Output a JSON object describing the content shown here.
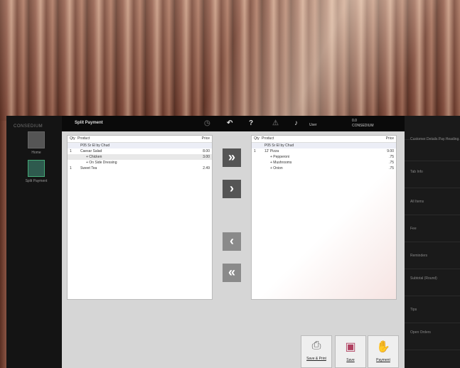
{
  "app": {
    "brand": "CONSEDIUM",
    "title": "Split Payment"
  },
  "left_nav": [
    {
      "label": "Home",
      "icon": "home-icon"
    },
    {
      "label": "Split Payment",
      "icon": "split-payment-icon"
    }
  ],
  "topbar": {
    "user_label": "User",
    "status_line1": "0.0",
    "status_line2": "CONSEDIUM"
  },
  "left_panel": {
    "headers": {
      "qty": "Qty",
      "product": "Product",
      "price": "Price"
    },
    "rows": [
      {
        "qty": "",
        "name": "P05 Sr El by Chud",
        "price": "",
        "indent": 1,
        "style": "sel"
      },
      {
        "qty": "1",
        "name": "Caesar Salad",
        "price": "8.00",
        "indent": 1,
        "style": ""
      },
      {
        "qty": "",
        "name": "+ Chicken",
        "price": "3.00",
        "indent": 2,
        "style": "hl"
      },
      {
        "qty": "",
        "name": "+ On Side Dressing",
        "price": "",
        "indent": 2,
        "style": ""
      },
      {
        "qty": "1",
        "name": "Sweet Tea",
        "price": "2.49",
        "indent": 1,
        "style": ""
      }
    ]
  },
  "right_panel": {
    "headers": {
      "qty": "Qty",
      "product": "Product",
      "price": "Price"
    },
    "rows": [
      {
        "qty": "",
        "name": "P05 Sr El by Chud",
        "price": "",
        "indent": 1,
        "style": "sel"
      },
      {
        "qty": "1",
        "name": "12' Pizza",
        "price": "9.00",
        "indent": 1,
        "style": ""
      },
      {
        "qty": "",
        "name": "+ Pepperoni",
        "price": ".75",
        "indent": 2,
        "style": ""
      },
      {
        "qty": "",
        "name": "+ Mushrooms",
        "price": ".75",
        "indent": 2,
        "style": ""
      },
      {
        "qty": "",
        "name": "+ Onion",
        "price": ".75",
        "indent": 2,
        "style": ""
      }
    ]
  },
  "move_buttons": {
    "all_right": "»",
    "one_right": "›",
    "one_left": "‹",
    "all_left": "«"
  },
  "actions": [
    {
      "label": "Save & Print",
      "icon": "print-icon"
    },
    {
      "label": "Save",
      "icon": "save-icon"
    },
    {
      "label": "Payment",
      "icon": "payment-icon"
    }
  ],
  "right_sidebar": {
    "header": "",
    "items": [
      "Customer Details Pay Heading",
      "Tab Info",
      "All Items",
      "Fee",
      "Reminders",
      "Subtotal (Round)",
      "Tips",
      "Open Orders"
    ]
  },
  "colors": {
    "close": "#e53935",
    "app_bg": "#111111",
    "content_bg": "#d6d6d6",
    "move_btn": "#555555"
  }
}
